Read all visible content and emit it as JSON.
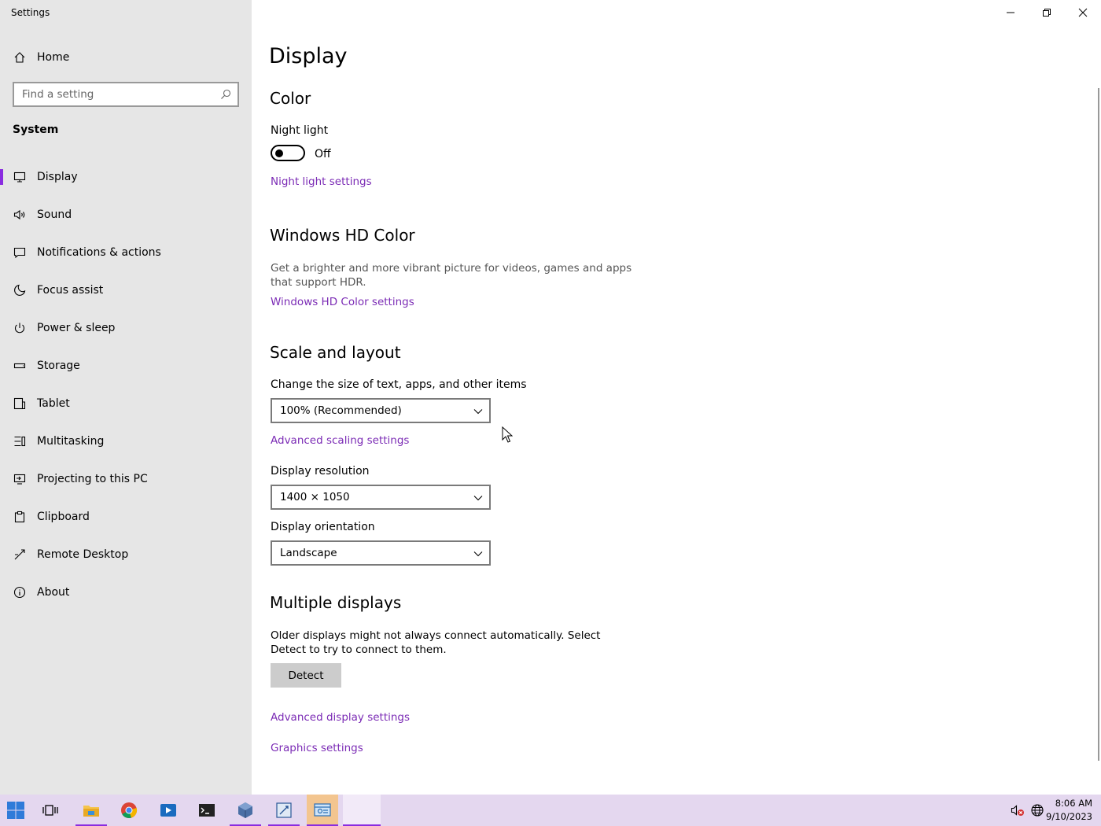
{
  "app": {
    "title": "Settings"
  },
  "sidebar": {
    "home_label": "Home",
    "search_placeholder": "Find a setting",
    "group_label": "System",
    "items": [
      {
        "label": "Display",
        "icon": "monitor-icon",
        "active": true
      },
      {
        "label": "Sound",
        "icon": "speaker-icon"
      },
      {
        "label": "Notifications & actions",
        "icon": "notification-icon"
      },
      {
        "label": "Focus assist",
        "icon": "moon-icon"
      },
      {
        "label": "Power & sleep",
        "icon": "power-icon"
      },
      {
        "label": "Storage",
        "icon": "storage-icon"
      },
      {
        "label": "Tablet",
        "icon": "tablet-icon"
      },
      {
        "label": "Multitasking",
        "icon": "multitasking-icon"
      },
      {
        "label": "Projecting to this PC",
        "icon": "projecting-icon"
      },
      {
        "label": "Clipboard",
        "icon": "clipboard-icon"
      },
      {
        "label": "Remote Desktop",
        "icon": "remote-desktop-icon"
      },
      {
        "label": "About",
        "icon": "info-icon"
      }
    ]
  },
  "main": {
    "title": "Display",
    "color": {
      "heading": "Color",
      "night_light_label": "Night light",
      "night_light_state": "Off",
      "night_light_settings_link": "Night light settings"
    },
    "hd_color": {
      "heading": "Windows HD Color",
      "description": "Get a brighter and more vibrant picture for videos, games and apps that support HDR.",
      "link": "Windows HD Color settings"
    },
    "scale_layout": {
      "heading": "Scale and layout",
      "scale_label": "Change the size of text, apps, and other items",
      "scale_value": "100% (Recommended)",
      "advanced_scaling_link": "Advanced scaling settings",
      "resolution_label": "Display resolution",
      "resolution_value": "1400 × 1050",
      "orientation_label": "Display orientation",
      "orientation_value": "Landscape"
    },
    "multiple_displays": {
      "heading": "Multiple displays",
      "description": "Older displays might not always connect automatically. Select Detect to try to connect to them.",
      "detect_button": "Detect",
      "advanced_display_link": "Advanced display settings",
      "graphics_link": "Graphics settings"
    }
  },
  "taskbar": {
    "apps": [
      "start",
      "task-view",
      "file-explorer",
      "chrome",
      "media-player",
      "terminal",
      "virtualbox",
      "editor",
      "settings"
    ],
    "clock_time": "8:06 AM",
    "clock_date": "9/10/2023"
  },
  "colors": {
    "accent": "#8a2ce0",
    "link": "#7b2bb5",
    "sidebar_bg": "#e6e6e6",
    "taskbar_bg": "#e4d7ef"
  }
}
